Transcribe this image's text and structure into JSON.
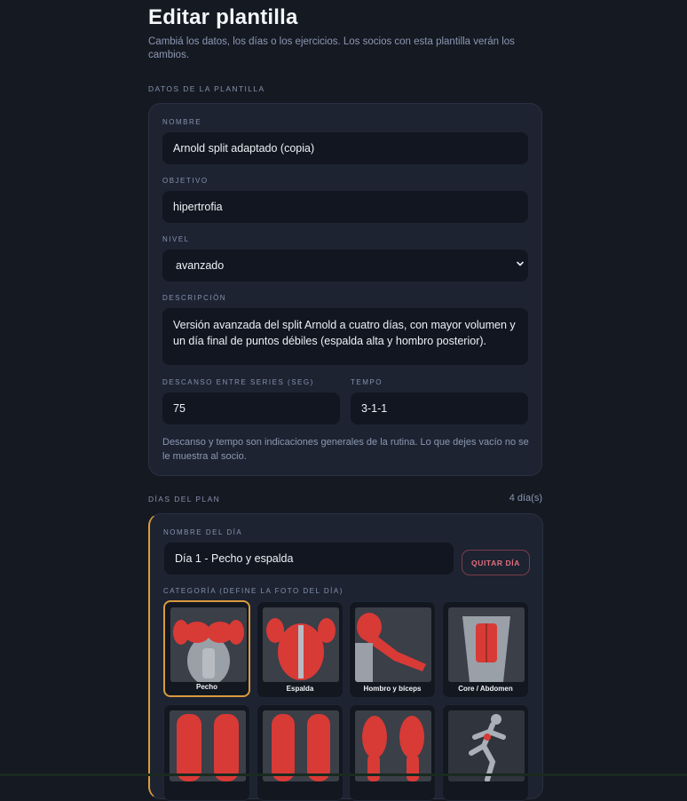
{
  "header": {
    "title": "Editar plantilla",
    "subtitle": "Cambiá los datos, los días o los ejercicios. Los socios con esta plantilla verán los cambios."
  },
  "template_section": {
    "label": "DATOS DE LA PLANTILLA",
    "nombre": {
      "label": "NOMBRE",
      "value": "Arnold split adaptado (copia)"
    },
    "objetivo": {
      "label": "OBJETIVO",
      "value": "hipertrofia"
    },
    "nivel": {
      "label": "NIVEL",
      "value": "avanzado"
    },
    "descripcion": {
      "label": "DESCRIPCIÓN",
      "value": "Versión avanzada del split Arnold a cuatro días, con mayor volumen y un día final de puntos débiles (espalda alta y hombro posterior)."
    },
    "descanso": {
      "label": "DESCANSO ENTRE SERIES (SEG)",
      "value": "75"
    },
    "tempo": {
      "label": "TEMPO",
      "value": "3-1-1"
    },
    "help": "Descanso y tempo son indicaciones generales de la rutina. Lo que dejes vacío no se le muestra al socio."
  },
  "days_section": {
    "label": "DÍAS DEL PLAN",
    "count": "4 día(s)",
    "day": {
      "name_label": "NOMBRE DEL DÍA",
      "name_value": "Día 1 - Pecho y espalda",
      "remove_label": "QUITAR DÍA",
      "category_label": "CATEGORÍA (DEFINE LA FOTO DEL DÍA)",
      "categories": [
        "Pecho",
        "Espalda",
        "Hombro y bíceps",
        "Core / Abdomen"
      ],
      "selected_category": "Pecho"
    }
  },
  "colors": {
    "accent": "#d99a3e",
    "danger": "#e0707e",
    "background": "#151922",
    "card": "#1d2331",
    "input": "#111620"
  }
}
